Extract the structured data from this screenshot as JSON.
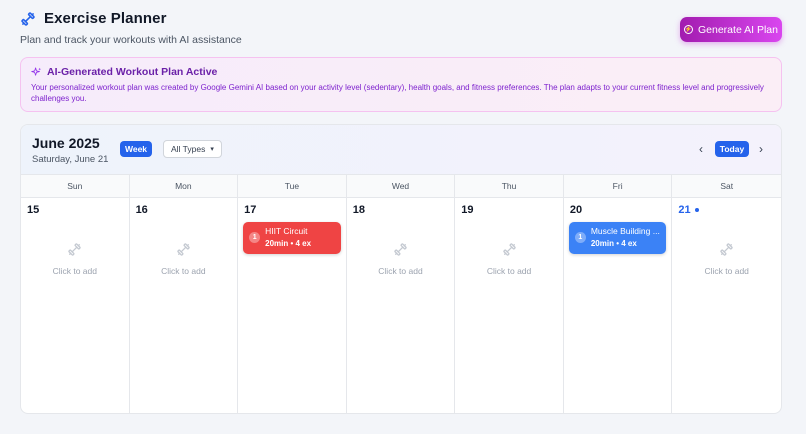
{
  "header": {
    "title": "Exercise Planner",
    "subtitle": "Plan and track your workouts with AI assistance",
    "generate_button": "Generate AI Plan"
  },
  "banner": {
    "title": "AI-Generated Workout Plan Active",
    "text": "Your personalized workout plan was created by Google Gemini AI based on your activity level (sedentary), health goals, and fitness preferences. The plan adapts to your current fitness level and progressively challenges you."
  },
  "calendar": {
    "month": "June 2025",
    "selected_date": "Saturday, June 21",
    "view_button": "Week",
    "type_filter": "All Types",
    "today_button": "Today",
    "weekdays": [
      "Sun",
      "Mon",
      "Tue",
      "Wed",
      "Thu",
      "Fri",
      "Sat"
    ],
    "empty_text": "Click to add",
    "days": [
      {
        "number": "15"
      },
      {
        "number": "16"
      },
      {
        "number": "17",
        "workout": {
          "index": "1",
          "name": "HIIT Circuit",
          "meta": "20min • 4 ex",
          "color": "#ef4444"
        }
      },
      {
        "number": "18"
      },
      {
        "number": "19"
      },
      {
        "number": "20",
        "workout": {
          "index": "1",
          "name": "Muscle Building ...",
          "meta": "20min • 4 ex",
          "color": "#3b82f6"
        }
      },
      {
        "number": "21",
        "is_today": true
      }
    ]
  },
  "colors": {
    "accent_blue": "#2563eb",
    "ai_gradient_start": "#a21caf",
    "ai_gradient_end": "#d946ef"
  }
}
